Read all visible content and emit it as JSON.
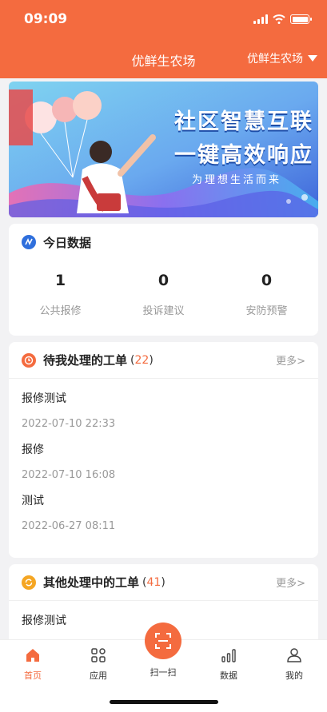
{
  "status_bar": {
    "time": "09:09"
  },
  "nav": {
    "title": "优鲜生农场",
    "selector": "优鲜生农场"
  },
  "banner": {
    "line1": "社区智慧互联",
    "line2": "一键高效响应",
    "sub": "为理想生活而来"
  },
  "today": {
    "title": "今日数据",
    "stats": [
      {
        "value": "1",
        "label": "公共报修"
      },
      {
        "value": "0",
        "label": "投诉建议"
      },
      {
        "value": "0",
        "label": "安防预警"
      }
    ]
  },
  "pending": {
    "title": "待我处理的工单",
    "count": "22",
    "more": "更多>",
    "items": [
      {
        "title": "报修测试",
        "time": "2022-07-10 22:33"
      },
      {
        "title": "报修",
        "time": "2022-07-10 16:08"
      },
      {
        "title": "测试",
        "time": "2022-06-27 08:11"
      }
    ]
  },
  "others": {
    "title": "其他处理中的工单",
    "count": "41",
    "more": "更多>",
    "items": [
      {
        "title": "报修测试"
      }
    ]
  },
  "tabbar": {
    "home": "首页",
    "apps": "应用",
    "scan": "扫一扫",
    "data": "数据",
    "mine": "我的"
  },
  "colors": {
    "brand": "#f46b3f",
    "today_icon": "#2f6fdc",
    "pending_icon": "#f46b3f",
    "others_icon": "#f5a623"
  },
  "icons": [
    "signal-icon",
    "wifi-icon",
    "battery-icon",
    "dropdown-triangle-icon",
    "data-icon",
    "clock-icon",
    "refresh-icon",
    "home-icon",
    "apps-icon",
    "scan-icon",
    "chart-icon",
    "user-icon"
  ]
}
